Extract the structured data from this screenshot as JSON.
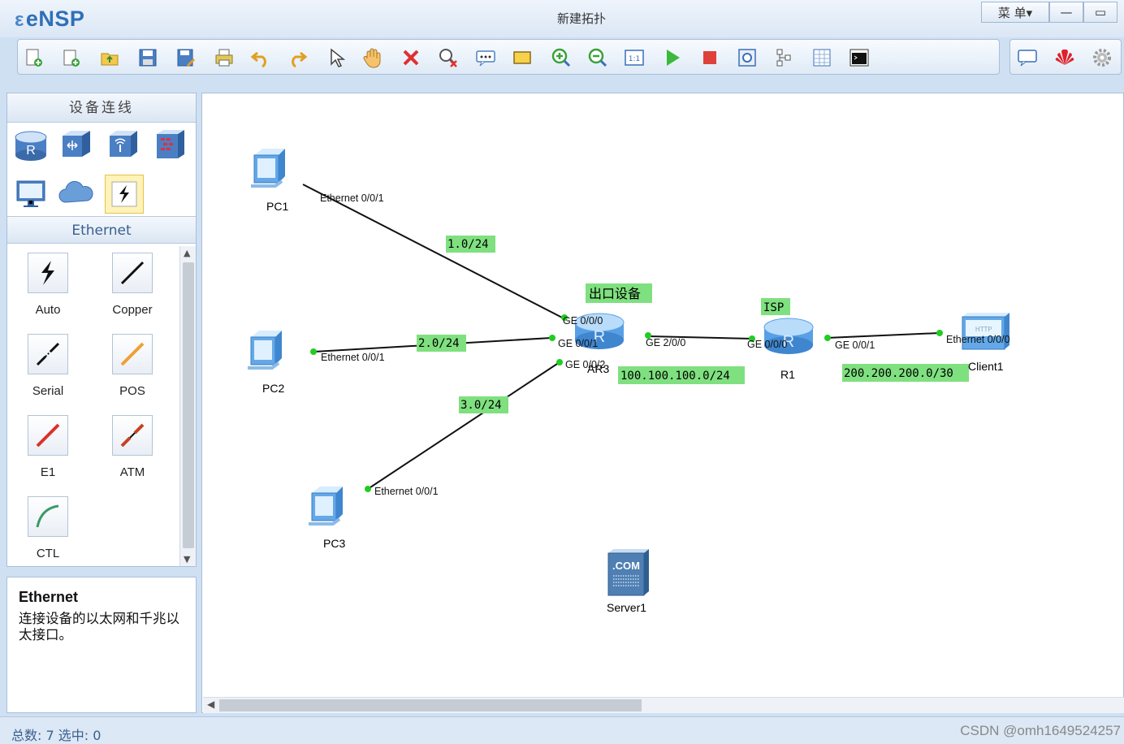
{
  "app": {
    "logo": "eNSP",
    "window_title": "新建拓扑"
  },
  "window_controls": {
    "menu_label": "菜 单▾",
    "minimize": "—",
    "maximize": "▭"
  },
  "toolbar": {
    "tools": [
      "new-topology-icon",
      "new-sheet-icon",
      "open-icon",
      "save-icon",
      "save-as-icon",
      "print-icon",
      "undo-icon",
      "redo-icon",
      "select-icon",
      "hand-icon",
      "delete-icon",
      "delete-link-icon",
      "text-icon",
      "rectangle-icon",
      "zoom-in-icon",
      "zoom-out-icon",
      "fit-icon",
      "start-icon",
      "stop-icon",
      "capture-icon",
      "topology-icon",
      "grid-icon",
      "console-icon"
    ],
    "right_tools": [
      "chat-icon",
      "huawei-icon",
      "settings-icon"
    ]
  },
  "left_panel": {
    "title": "设备连线",
    "categories": [
      "router-icon",
      "switch-icon",
      "wireless-icon",
      "firewall-icon",
      "terminal-icon",
      "cloud-icon",
      "cable-icon"
    ],
    "selected_category": "cable-icon",
    "subcategory_title": "Ethernet",
    "cables": [
      {
        "label": "Auto",
        "icon": "auto-cable-icon",
        "color": "#111111"
      },
      {
        "label": "Copper",
        "icon": "copper-cable-icon",
        "color": "#111111"
      },
      {
        "label": "Serial",
        "icon": "serial-cable-icon",
        "color": "#111111"
      },
      {
        "label": "POS",
        "icon": "pos-cable-icon",
        "color": "#f0a030"
      },
      {
        "label": "E1",
        "icon": "e1-cable-icon",
        "color": "#d8332a"
      },
      {
        "label": "ATM",
        "icon": "atm-cable-icon",
        "color": "#c8401f"
      },
      {
        "label": "CTL",
        "icon": "ctl-cable-icon",
        "color": "#3a9a6a"
      }
    ]
  },
  "description": {
    "title": "Ethernet",
    "text": "连接设备的以太网和千兆以太接口。"
  },
  "topology": {
    "devices": [
      {
        "name": "PC1",
        "type": "pc"
      },
      {
        "name": "PC2",
        "type": "pc"
      },
      {
        "name": "PC3",
        "type": "pc"
      },
      {
        "name": "AR3",
        "type": "router",
        "tag": "出口设备"
      },
      {
        "name": "R1",
        "type": "router",
        "tag": "ISP"
      },
      {
        "name": "Client1",
        "type": "client"
      },
      {
        "name": "Server1",
        "type": "server"
      }
    ],
    "ports": {
      "pc1_eth": "Ethernet 0/0/1",
      "pc2_eth": "Ethernet 0/0/1",
      "pc3_eth": "Ethernet 0/0/1",
      "ar3_ge000": "GE 0/0/0",
      "ar3_ge001": "GE 0/0/1",
      "ar3_ge002": "GE 0/0/2",
      "ar3_ge200": "GE 2/0/0",
      "r1_ge000": "GE 0/0/0",
      "r1_ge001": "GE 0/0/1",
      "client_eth": "Ethernet 0/0/0"
    },
    "subnets": {
      "pc1_link": "1.0/24",
      "pc2_link": "2.0/24",
      "pc3_link": "3.0/24",
      "ar3_r1": "100.100.100.0/24",
      "r1_client": "200.200.200.0/30"
    },
    "colors": {
      "label_bg": "#7fe07f",
      "link": "#111111",
      "port_dot": "#22cc22"
    }
  },
  "status": {
    "summary": "总数: 7  选中: 0",
    "watermark": "CSDN @omh1649524257"
  }
}
